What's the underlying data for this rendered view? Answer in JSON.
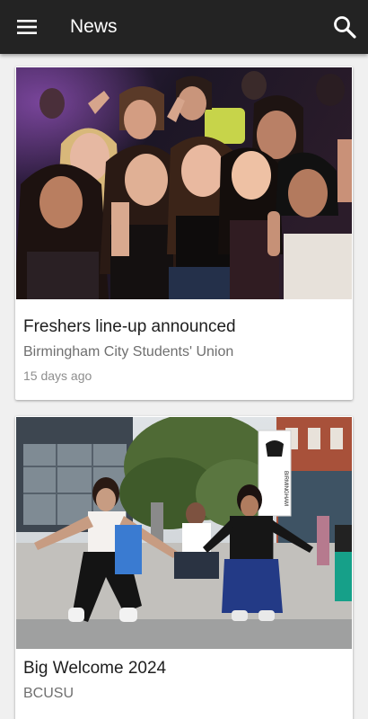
{
  "app_bar": {
    "title": "News",
    "menu_icon": "menu-icon",
    "search_icon": "search-icon",
    "background": "#232323"
  },
  "articles": [
    {
      "title": "Freshers line-up announced",
      "source": "Birmingham City Students' Union",
      "time": "15 days ago",
      "image": "photo-crowd-at-party"
    },
    {
      "title": "Big Welcome 2024",
      "source": "BCUSU",
      "image": "photo-students-dancing-outdoors",
      "image_sign": "BIRMINGHAM UNIVERSITY"
    }
  ]
}
